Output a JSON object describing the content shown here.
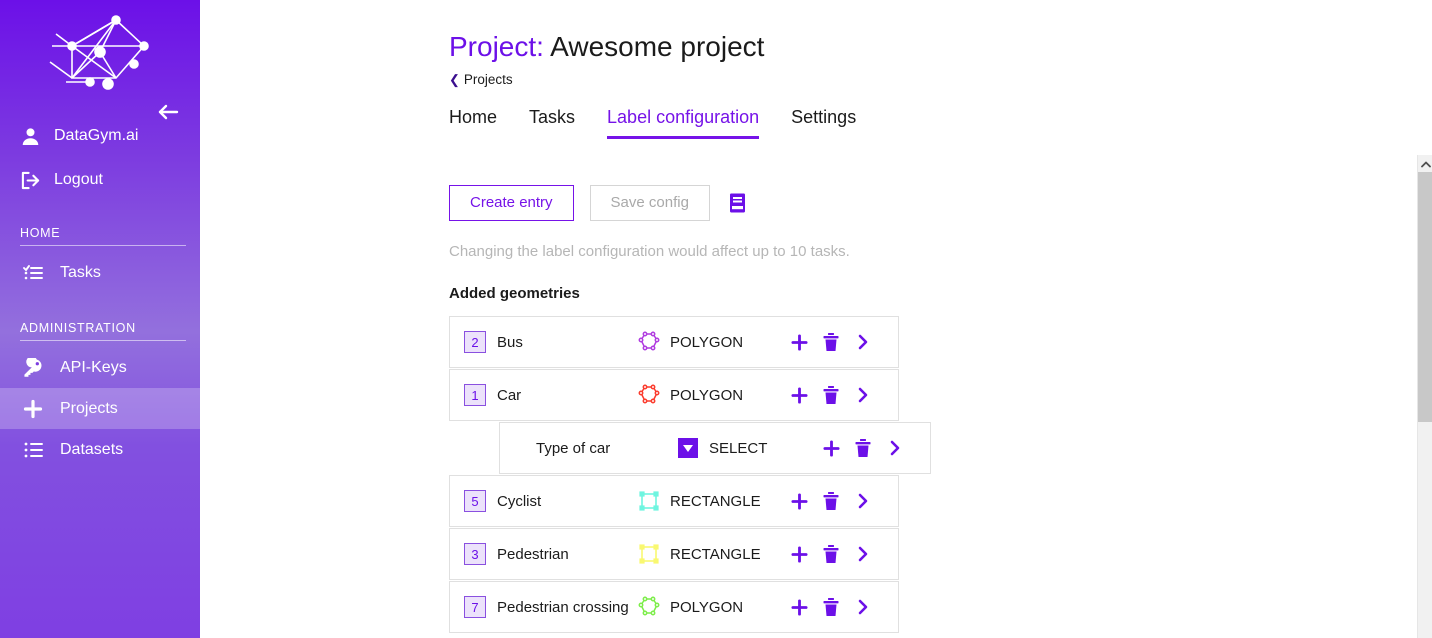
{
  "sidebar": {
    "logo_icon": "network-graph-logo",
    "collapse_icon": "arrow-left-icon",
    "user": {
      "label": "DataGym.ai",
      "icon": "user-icon"
    },
    "logout": {
      "label": "Logout",
      "icon": "logout-icon"
    },
    "sections": [
      {
        "label": "HOME",
        "items": [
          {
            "label": "Tasks",
            "icon": "checklist-icon",
            "active": false
          }
        ]
      },
      {
        "label": "ADMINISTRATION",
        "items": [
          {
            "label": "API-Keys",
            "icon": "key-icon",
            "active": false
          },
          {
            "label": "Projects",
            "icon": "plus-icon",
            "active": true
          },
          {
            "label": "Datasets",
            "icon": "list-icon",
            "active": false
          }
        ]
      }
    ]
  },
  "header": {
    "title_prefix": "Project:",
    "title_name": "Awesome project",
    "breadcrumb": "Projects",
    "breadcrumb_icon": "chevron-left-icon"
  },
  "tabs": [
    {
      "label": "Home",
      "active": false
    },
    {
      "label": "Tasks",
      "active": false
    },
    {
      "label": "Label configuration",
      "active": true
    },
    {
      "label": "Settings",
      "active": false
    }
  ],
  "toolbar": {
    "create_entry_label": "Create entry",
    "save_config_label": "Save config",
    "book_icon": "book-icon"
  },
  "notice": "Changing the label configuration would affect up to 10 tasks.",
  "section_title": "Added geometries",
  "geometries": [
    {
      "badge": "2",
      "name": "Bus",
      "type": "POLYGON",
      "shape": "polygon",
      "color": "#b03ce0",
      "child": false
    },
    {
      "badge": "1",
      "name": "Car",
      "type": "POLYGON",
      "shape": "polygon",
      "color": "#fb3b2d",
      "child": false
    },
    {
      "badge": "",
      "name": "Type of car",
      "type": "SELECT",
      "shape": "select",
      "color": "#6c10e8",
      "child": true
    },
    {
      "badge": "5",
      "name": "Cyclist",
      "type": "RECTANGLE",
      "shape": "rectangle",
      "color": "#6ff5e0",
      "child": false
    },
    {
      "badge": "3",
      "name": "Pedestrian",
      "type": "RECTANGLE",
      "shape": "rectangle",
      "color": "#f9f871",
      "child": false
    },
    {
      "badge": "7",
      "name": "Pedestrian crossing",
      "type": "POLYGON",
      "shape": "polygon",
      "color": "#7ded4a",
      "child": false
    }
  ],
  "row_actions": {
    "add_icon": "plus-icon",
    "delete_icon": "trash-icon",
    "expand_icon": "chevron-right-icon"
  },
  "scrollbar": {
    "up_icon": "chevron-up-icon"
  },
  "colors": {
    "accent": "#6c10e8",
    "accent_alt": "#7613e8",
    "sidebar_top": "#6c10e8",
    "muted_text": "#b6b6b6",
    "border": "#e0e0e0"
  }
}
